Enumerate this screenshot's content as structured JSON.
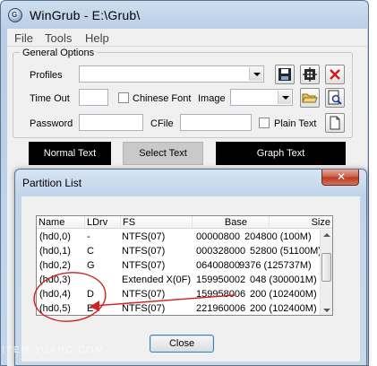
{
  "window": {
    "title": "WinGrub - E:\\Grub\\"
  },
  "menu": [
    "File",
    "Tools",
    "Help"
  ],
  "general_options": {
    "legend": "General Options",
    "profiles_label": "Profiles",
    "profiles_value": "",
    "timeout_label": "Time Out",
    "timeout_value": "",
    "chinese_font_label": "Chinese Font",
    "chinese_font_checked": false,
    "image_label": "Image",
    "image_value": "",
    "password_label": "Password",
    "password_value": "",
    "cfile_label": "CFile",
    "cfile_value": "",
    "plain_text_label": "Plain Text",
    "plain_text_checked": false
  },
  "buttons": {
    "normal_text": "Normal Text",
    "select_text": "Select Text",
    "graph_text": "Graph Text"
  },
  "dialog": {
    "title": "Partition List",
    "close_label": "Close",
    "columns": [
      "Name",
      "LDrv",
      "FS",
      "Base",
      "Size"
    ],
    "rows": [
      {
        "name": "(hd0,0)",
        "ldrv": "-",
        "fs": "NTFS(07)",
        "base": "00000800",
        "size": "204800 (100M)"
      },
      {
        "name": "(hd0,1)",
        "ldrv": "C",
        "fs": "NTFS(07)",
        "base": "000328000",
        "size": "52800 (51100M)"
      },
      {
        "name": "(hd0,2)",
        "ldrv": "G",
        "fs": "NTFS(07)",
        "base": "06400800",
        "size": "9376 (125737M)"
      },
      {
        "name": "(hd0,3)",
        "ldrv": "",
        "fs": "Extended X(0F)",
        "base": "159950002",
        "size": "048 (300001M)"
      },
      {
        "name": "(hd0,4)",
        "ldrv": "D",
        "fs": "NTFS(07)",
        "base": "159958006",
        "size": "200 (102400M)"
      },
      {
        "name": "(hd0,5)",
        "ldrv": "E",
        "fs": "NTFS(07)",
        "base": "221960006",
        "size": "200 (102400M)"
      }
    ]
  },
  "watermark": "ITEM.3UANC.COM",
  "colors": {
    "annotation": "#d42020",
    "button_black": "#000000",
    "button_grey": "#c9c9c9"
  }
}
